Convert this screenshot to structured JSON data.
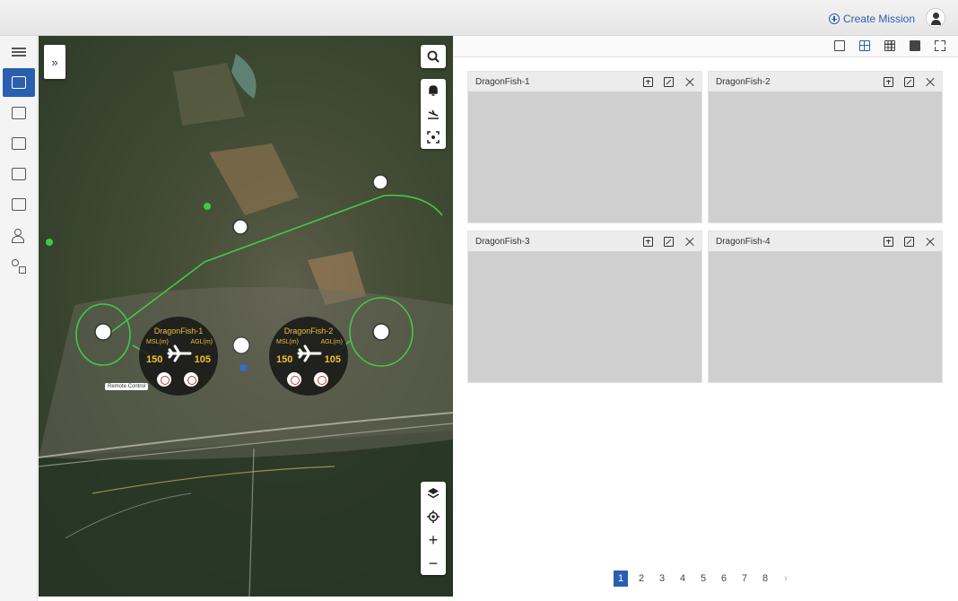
{
  "header": {
    "create_mission_label": "Create Mission",
    "user_icon": "user-icon"
  },
  "sidebar": {
    "items": [
      {
        "icon": "list-icon",
        "active": false
      },
      {
        "icon": "map-mission-icon",
        "active": true
      },
      {
        "icon": "calendar-icon",
        "active": false
      },
      {
        "icon": "image-icon",
        "active": false
      },
      {
        "icon": "schedule-icon",
        "active": false
      },
      {
        "icon": "monitor-icon",
        "active": false
      },
      {
        "icon": "users-icon",
        "active": false
      },
      {
        "icon": "apps-icon",
        "active": false
      }
    ]
  },
  "map": {
    "expand_glyph": "»",
    "drones": [
      {
        "name": "DragonFish-1",
        "left_label": "MSL(m)",
        "right_label": "AGL(m)",
        "left_value": "150",
        "right_value": "105"
      },
      {
        "name": "DragonFish-2",
        "left_label": "MSL(m)",
        "right_label": "AGL(m)",
        "left_value": "150",
        "right_value": "105"
      }
    ],
    "tooltip": "Remote Control",
    "controls_top": [
      "search-icon"
    ],
    "controls_mid": [
      "bell-icon",
      "landing-icon",
      "focus-icon"
    ],
    "controls_bottom": [
      "layers-icon",
      "locate-icon",
      "zoom-in-icon",
      "zoom-out-icon"
    ],
    "zoom_in_glyph": "+",
    "zoom_out_glyph": "−"
  },
  "layout_toolbar": {
    "options": [
      "layout-1-icon",
      "layout-4-icon",
      "layout-9-icon",
      "layout-16-icon",
      "fullscreen-icon"
    ],
    "active": "layout-4-icon"
  },
  "video_cells": [
    {
      "title": "DragonFish-1"
    },
    {
      "title": "DragonFish-2"
    },
    {
      "title": "DragonFish-3"
    },
    {
      "title": "DragonFish-4"
    }
  ],
  "pagination": {
    "pages": [
      "1",
      "2",
      "3",
      "4",
      "5",
      "6",
      "7",
      "8"
    ],
    "current": "1",
    "next_glyph": "›"
  },
  "colors": {
    "accent": "#2a5fb0",
    "route": "#3fc94a",
    "drone_label": "#e8c13a"
  }
}
